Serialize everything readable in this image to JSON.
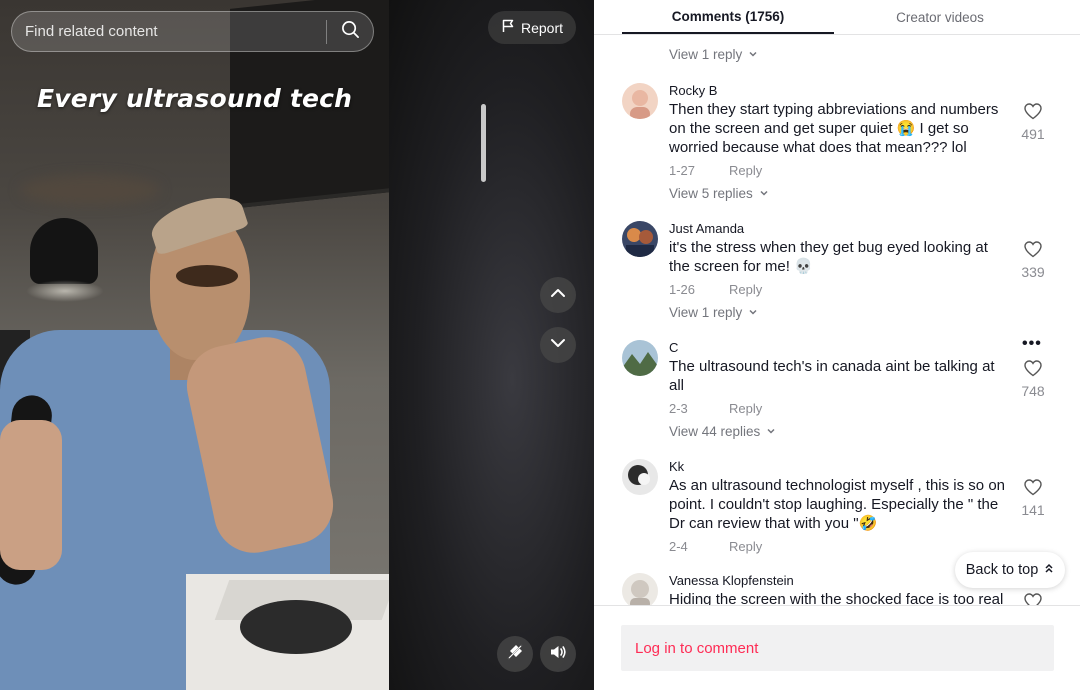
{
  "video": {
    "search": {
      "placeholder": "Find related content"
    },
    "report_label": "Report",
    "overlay_text": "Every ultrasound tech"
  },
  "tabs": {
    "comments": "Comments (1756)",
    "creator": "Creator videos"
  },
  "top_view_replies": "View 1 reply",
  "comments": [
    {
      "name": "Rocky B",
      "text": "Then they start typing abbreviations and numbers on the screen and get super quiet 😭 I get so worried because what does that mean??? lol",
      "date": "1-27",
      "reply_label": "Reply",
      "likes": "491",
      "view_replies": "View 5 replies",
      "avatar_color": "#e9b7a2"
    },
    {
      "name": "Just Amanda",
      "text": "it's the stress when they get bug eyed looking at the screen for me! 💀",
      "date": "1-26",
      "reply_label": "Reply",
      "likes": "339",
      "view_replies": "View 1 reply",
      "avatar_color": "#4a5a7a"
    },
    {
      "name": "C",
      "text": "The ultrasound tech's in canada aint be talking at all",
      "date": "2-3",
      "reply_label": "Reply",
      "likes": "748",
      "view_replies": "View 44 replies",
      "more": "•••",
      "avatar_color": "#6b8b5e"
    },
    {
      "name": "Kk",
      "text": "As an ultrasound technologist myself , this is so on point. I couldn't stop laughing. Especially the \" the Dr can review that with you \"🤣",
      "date": "2-4",
      "reply_label": "Reply",
      "likes": "141",
      "avatar_color": "#2c2c2c"
    },
    {
      "name": "Vanessa Klopfenstein",
      "text": "Hiding the screen with the shocked face is too real",
      "avatar_color": "#d9d5d0"
    }
  ],
  "back_to_top": "Back to top",
  "login_label": "Log in to comment",
  "colors": {
    "accent": "#fe2c55",
    "text": "#161823",
    "secondary": "#8a8b91"
  }
}
